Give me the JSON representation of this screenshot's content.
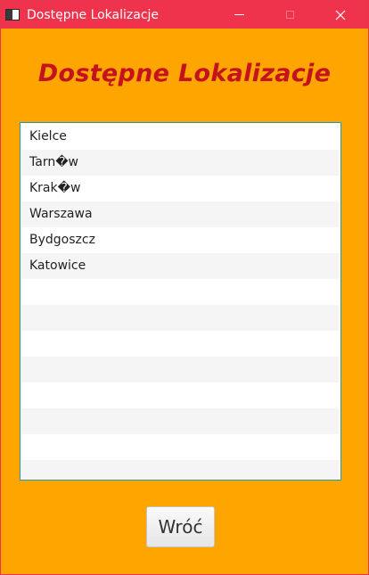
{
  "window": {
    "title": "Dostępne Lokalizacje",
    "minimize_icon": "minimize-icon",
    "maximize_icon": "maximize-icon",
    "close_icon": "close-icon",
    "close_glyph": "✕"
  },
  "heading": "Dostępne Lokalizacje",
  "locations": [
    "Kielce",
    "Tarn�w",
    "Krak�w",
    "Warszawa",
    "Bydgoszcz",
    "Katowice",
    "",
    "",
    "",
    "",
    "",
    "",
    "",
    ""
  ],
  "back_button": "Wróć",
  "colors": {
    "titlebar": "#f0334c",
    "background": "#ffa500",
    "heading": "#c4131f",
    "list_border": "#1f9db0"
  }
}
